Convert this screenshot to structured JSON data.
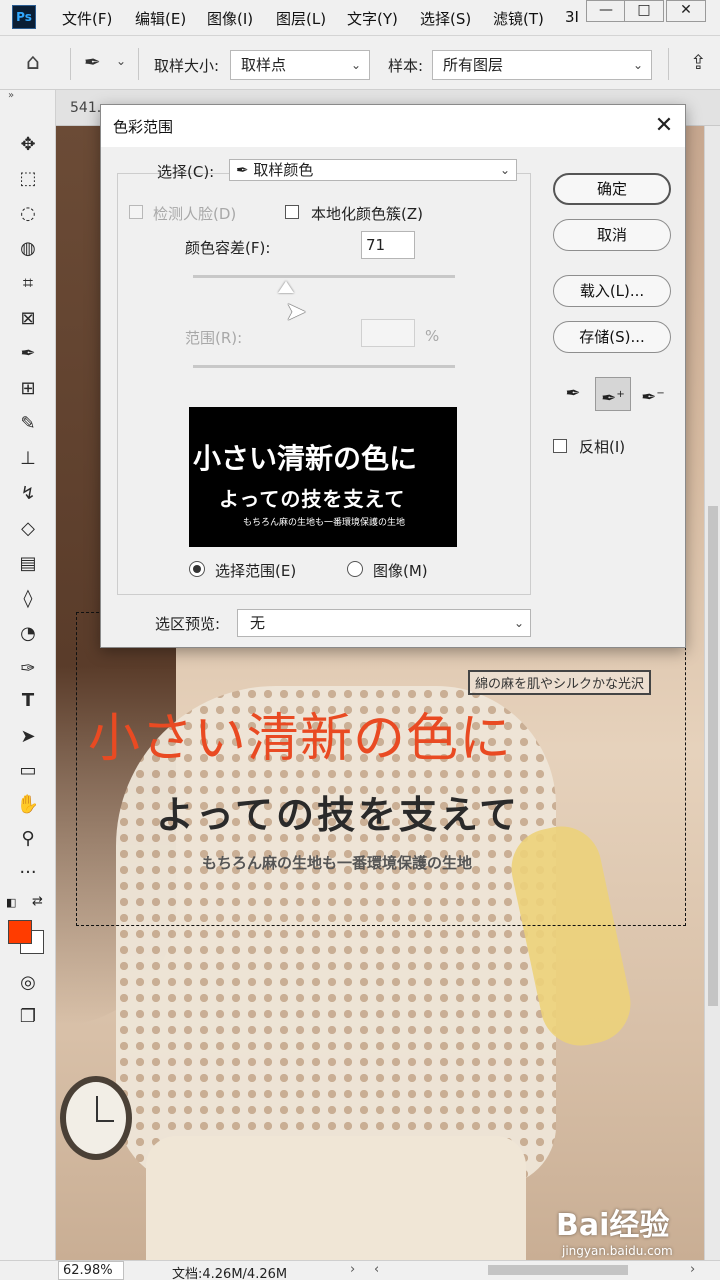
{
  "app": {
    "logo": "Ps"
  },
  "menu": {
    "items": [
      "文件(F)",
      "编辑(E)",
      "图像(I)",
      "图层(L)",
      "文字(Y)",
      "选择(S)",
      "滤镜(T)",
      "3I"
    ],
    "window_controls": [
      "minimize-icon",
      "maximize-icon",
      "close-icon"
    ]
  },
  "options_bar": {
    "sample_size_label": "取样大小:",
    "sample_size_value": "取样点",
    "sample_label": "样本:",
    "sample_value": "所有图层"
  },
  "doc_tab": {
    "title": "541..."
  },
  "canvas": {
    "poster_tag": "綿の麻を肌やシルクかな光沢",
    "poster_title": "小さい清新の色に",
    "poster_subtitle": "よっての技を支えて",
    "poster_small": "もちろん麻の生地も一番環境保護の生地",
    "watermark_brand": "Bai经验",
    "watermark_url": "jingyan.baidu.com"
  },
  "status": {
    "zoom": "62.98%",
    "doc_info": "文档:4.26M/4.26M"
  },
  "colors": {
    "foreground": "#ff3c00",
    "background": "#ffffff"
  },
  "dialog": {
    "title": "色彩范围",
    "select_label": "选择(C):",
    "select_value": "取样颜色",
    "detect_faces_label": "检测人脸(D)",
    "localized_clusters_label": "本地化颜色簇(Z)",
    "fuzziness_label": "颜色容差(F):",
    "fuzziness_value": "71",
    "range_label": "范围(R):",
    "range_unit": "%",
    "preview_line1": "小さい清新の色に",
    "preview_line2": "よっての技を支えて",
    "preview_line3": "もちろん麻の生地も一番環境保護の生地",
    "radio_selection": "选择范围(E)",
    "radio_image": "图像(M)",
    "selection_preview_label": "选区预览:",
    "selection_preview_value": "无",
    "buttons": {
      "ok": "确定",
      "cancel": "取消",
      "load": "载入(L)...",
      "save": "存储(S)..."
    },
    "invert_label": "反相(I)"
  }
}
